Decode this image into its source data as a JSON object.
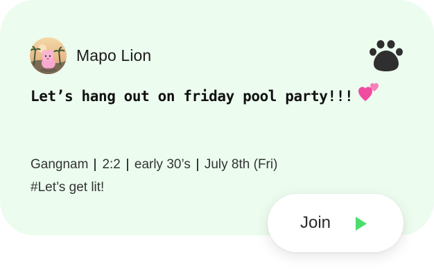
{
  "post": {
    "author": "Mapo Lion",
    "avatar_icon": "pink-character-beach-avatar",
    "menu_icon": "paw-icon",
    "text": "Let’s hang out on friday pool party!!!",
    "emoji_icon": "two-hearts-icon",
    "meta": {
      "location": "Gangnam",
      "ratio": "2:2",
      "age": "early 30’s",
      "date": "July 8th (Fri)"
    },
    "hashtag": "#Let’s get lit!"
  },
  "join_button": {
    "label": "Join",
    "icon": "play-icon",
    "icon_color": "#4ade6a"
  },
  "colors": {
    "card_background": "#ecfcef",
    "text": "#1b1b1b",
    "paw": "#2f2f2f",
    "hearts": "#f04ca0"
  }
}
